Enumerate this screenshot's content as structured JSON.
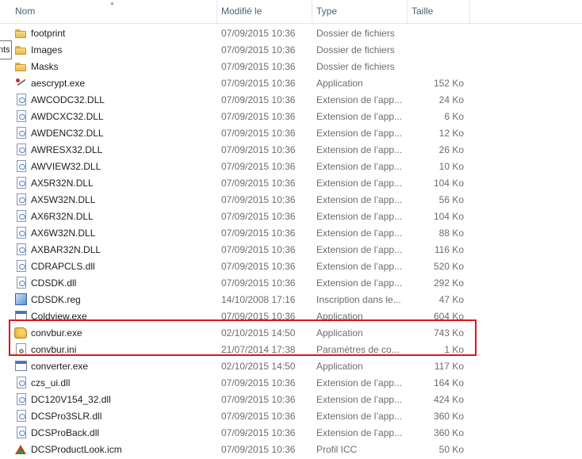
{
  "columns": {
    "name": "Nom",
    "modified": "Modifié le",
    "type": "Type",
    "size": "Taille"
  },
  "tooltip_fragment": "nts",
  "files": [
    {
      "name": "footprint",
      "date": "07/09/2015 10:36",
      "type": "Dossier de fichiers",
      "size": "",
      "icon": "folder-icon"
    },
    {
      "name": "Images",
      "date": "07/09/2015 10:36",
      "type": "Dossier de fichiers",
      "size": "",
      "icon": "folder-icon"
    },
    {
      "name": "Masks",
      "date": "07/09/2015 10:36",
      "type": "Dossier de fichiers",
      "size": "",
      "icon": "folder-icon"
    },
    {
      "name": "aescrypt.exe",
      "date": "07/09/2015 10:36",
      "type": "Application",
      "size": "152 Ko",
      "icon": "aescrypt-icon"
    },
    {
      "name": "AWCODC32.DLL",
      "date": "07/09/2015 10:36",
      "type": "Extension de l’app...",
      "size": "24 Ko",
      "icon": "dll-icon"
    },
    {
      "name": "AWDCXC32.DLL",
      "date": "07/09/2015 10:36",
      "type": "Extension de l’app...",
      "size": "6 Ko",
      "icon": "dll-icon"
    },
    {
      "name": "AWDENC32.DLL",
      "date": "07/09/2015 10:36",
      "type": "Extension de l’app...",
      "size": "12 Ko",
      "icon": "dll-icon"
    },
    {
      "name": "AWRESX32.DLL",
      "date": "07/09/2015 10:36",
      "type": "Extension de l’app...",
      "size": "26 Ko",
      "icon": "dll-icon"
    },
    {
      "name": "AWVIEW32.DLL",
      "date": "07/09/2015 10:36",
      "type": "Extension de l’app...",
      "size": "10 Ko",
      "icon": "dll-icon"
    },
    {
      "name": "AX5R32N.DLL",
      "date": "07/09/2015 10:36",
      "type": "Extension de l’app...",
      "size": "104 Ko",
      "icon": "dll-icon"
    },
    {
      "name": "AX5W32N.DLL",
      "date": "07/09/2015 10:36",
      "type": "Extension de l’app...",
      "size": "56 Ko",
      "icon": "dll-icon"
    },
    {
      "name": "AX6R32N.DLL",
      "date": "07/09/2015 10:36",
      "type": "Extension de l’app...",
      "size": "104 Ko",
      "icon": "dll-icon"
    },
    {
      "name": "AX6W32N.DLL",
      "date": "07/09/2015 10:36",
      "type": "Extension de l’app...",
      "size": "88 Ko",
      "icon": "dll-icon"
    },
    {
      "name": "AXBAR32N.DLL",
      "date": "07/09/2015 10:36",
      "type": "Extension de l’app...",
      "size": "116 Ko",
      "icon": "dll-icon"
    },
    {
      "name": "CDRAPCLS.dll",
      "date": "07/09/2015 10:36",
      "type": "Extension de l’app...",
      "size": "520 Ko",
      "icon": "dll-icon"
    },
    {
      "name": "CDSDK.dll",
      "date": "07/09/2015 10:36",
      "type": "Extension de l’app...",
      "size": "292 Ko",
      "icon": "dll-icon"
    },
    {
      "name": "CDSDK.reg",
      "date": "14/10/2008 17:16",
      "type": "Inscription dans le...",
      "size": "47 Ko",
      "icon": "registry-icon"
    },
    {
      "name": "Coldview.exe",
      "date": "07/09/2015 10:36",
      "type": "Application",
      "size": "604 Ko",
      "icon": "application-icon"
    },
    {
      "name": "convbur.exe",
      "date": "02/10/2015 14:50",
      "type": "Application",
      "size": "743 Ko",
      "icon": "convbur-app-icon"
    },
    {
      "name": "convbur.ini",
      "date": "21/07/2014 17:38",
      "type": "Paramètres de co...",
      "size": "1 Ko",
      "icon": "settings-file-icon"
    },
    {
      "name": "converter.exe",
      "date": "02/10/2015 14:50",
      "type": "Application",
      "size": "117 Ko",
      "icon": "application-icon"
    },
    {
      "name": "czs_ui.dll",
      "date": "07/09/2015 10:36",
      "type": "Extension de l’app...",
      "size": "164 Ko",
      "icon": "dll-icon"
    },
    {
      "name": "DC120V154_32.dll",
      "date": "07/09/2015 10:36",
      "type": "Extension de l’app...",
      "size": "424 Ko",
      "icon": "dll-icon"
    },
    {
      "name": "DCSPro3SLR.dll",
      "date": "07/09/2015 10:36",
      "type": "Extension de l’app...",
      "size": "360 Ko",
      "icon": "dll-icon"
    },
    {
      "name": "DCSProBack.dll",
      "date": "07/09/2015 10:36",
      "type": "Extension de l’app...",
      "size": "360 Ko",
      "icon": "dll-icon"
    },
    {
      "name": "DCSProductLook.icm",
      "date": "07/09/2015 10:36",
      "type": "Profil ICC",
      "size": "50 Ko",
      "icon": "color-profile-icon"
    }
  ],
  "highlight_color": "#e0141c"
}
